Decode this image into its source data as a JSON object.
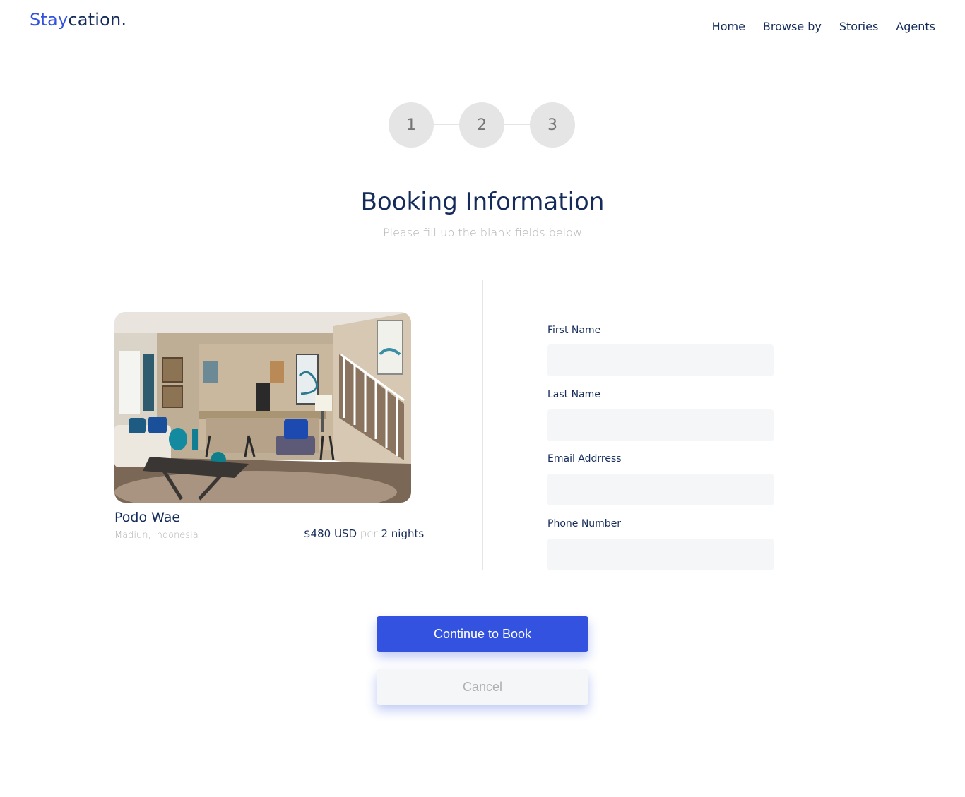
{
  "brand": {
    "part1": "Stay",
    "part2": "cation."
  },
  "nav": {
    "items": [
      "Home",
      "Browse by",
      "Stories",
      "Agents"
    ]
  },
  "stepper": {
    "steps": [
      "1",
      "2",
      "3"
    ]
  },
  "heading": {
    "title": "Booking Information",
    "subtitle": "Please fill up the blank fields below"
  },
  "property": {
    "name": "Podo Wae",
    "location": "Madiun, Indonesia",
    "price": "$480 USD",
    "per": "per",
    "duration": "2 nights"
  },
  "form": {
    "first_name_label": "First Name",
    "first_name_value": "",
    "last_name_label": "Last Name",
    "last_name_value": "",
    "email_label": "Email Addrress",
    "email_value": "",
    "phone_label": "Phone Number",
    "phone_value": ""
  },
  "actions": {
    "continue_label": "Continue to Book",
    "cancel_label": "Cancel"
  },
  "colors": {
    "primary": "#3252DF",
    "navy": "#152C5B",
    "muted": "#B0B0B0",
    "input_bg": "#F5F6F8",
    "step_bg": "#E5E5E5"
  }
}
